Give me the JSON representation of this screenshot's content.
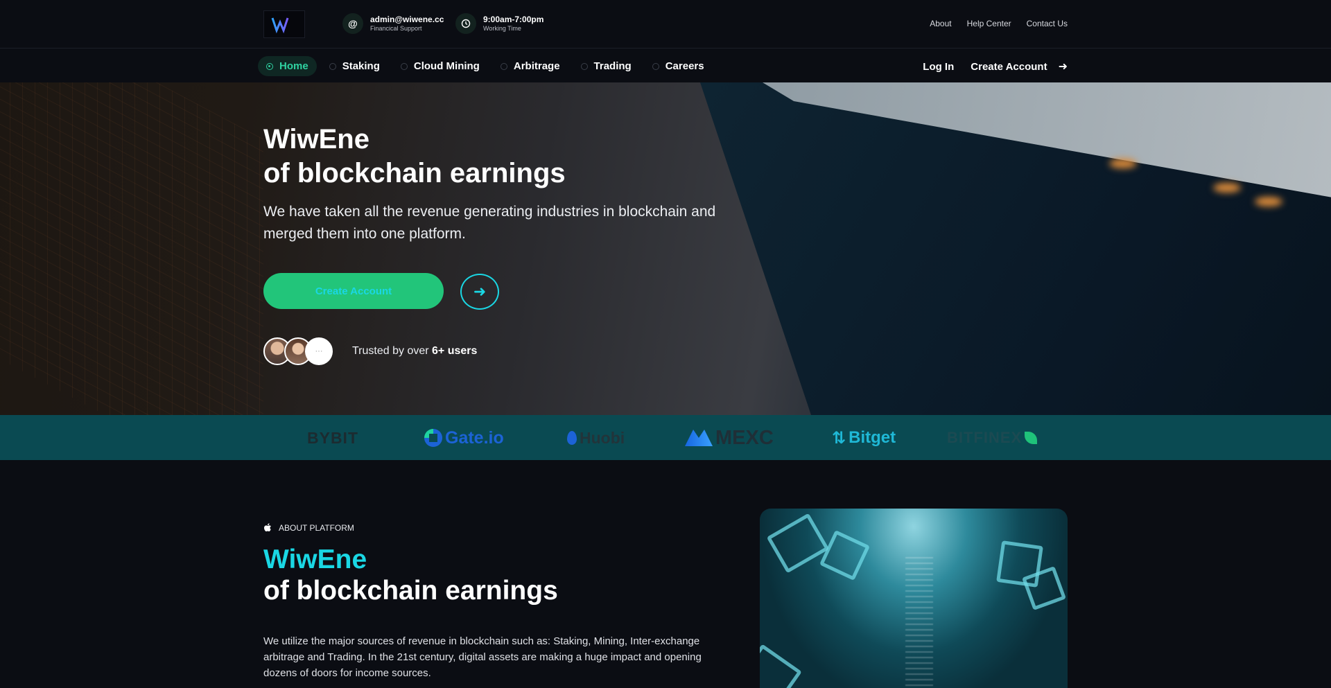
{
  "topbar": {
    "email": "admin@wiwene.cc",
    "email_caption": "Financical Support",
    "hours": "9:00am-7:00pm",
    "hours_caption": "Working Time",
    "links": [
      "About",
      "Help Center",
      "Contact Us"
    ]
  },
  "nav": {
    "items": [
      "Home",
      "Staking",
      "Cloud Mining",
      "Arbitrage",
      "Trading",
      "Careers"
    ],
    "active": "Home",
    "login": "Log In",
    "create_account": "Create Account"
  },
  "hero": {
    "title_line1": "WiwEne",
    "title_line2": "of blockchain earnings",
    "subtitle": "We have taken all the revenue generating industries in blockchain and merged them into one platform.",
    "cta": "Create Account",
    "trusted_prefix": "Trusted by over ",
    "trusted_count": "6+ users"
  },
  "partners": [
    "BYBIT",
    "Gate.io",
    "Huobi",
    "MEXC",
    "Bitget",
    "BITFINEX"
  ],
  "about": {
    "tag": "ABOUT PLATFORM",
    "title_accent": "WiwEne",
    "title_line2": "of blockchain earnings",
    "text": "We utilize the major sources of revenue in blockchain such as: Staking, Mining, Inter-exchange arbitrage and Trading. In the 21st century, digital assets are making a huge impact and opening dozens of doors for income sources."
  },
  "colors": {
    "accent_green": "#22c57a",
    "accent_cyan": "#1ad7e4",
    "background": "#0b0d13",
    "partner_strip": "#0a4a52"
  }
}
